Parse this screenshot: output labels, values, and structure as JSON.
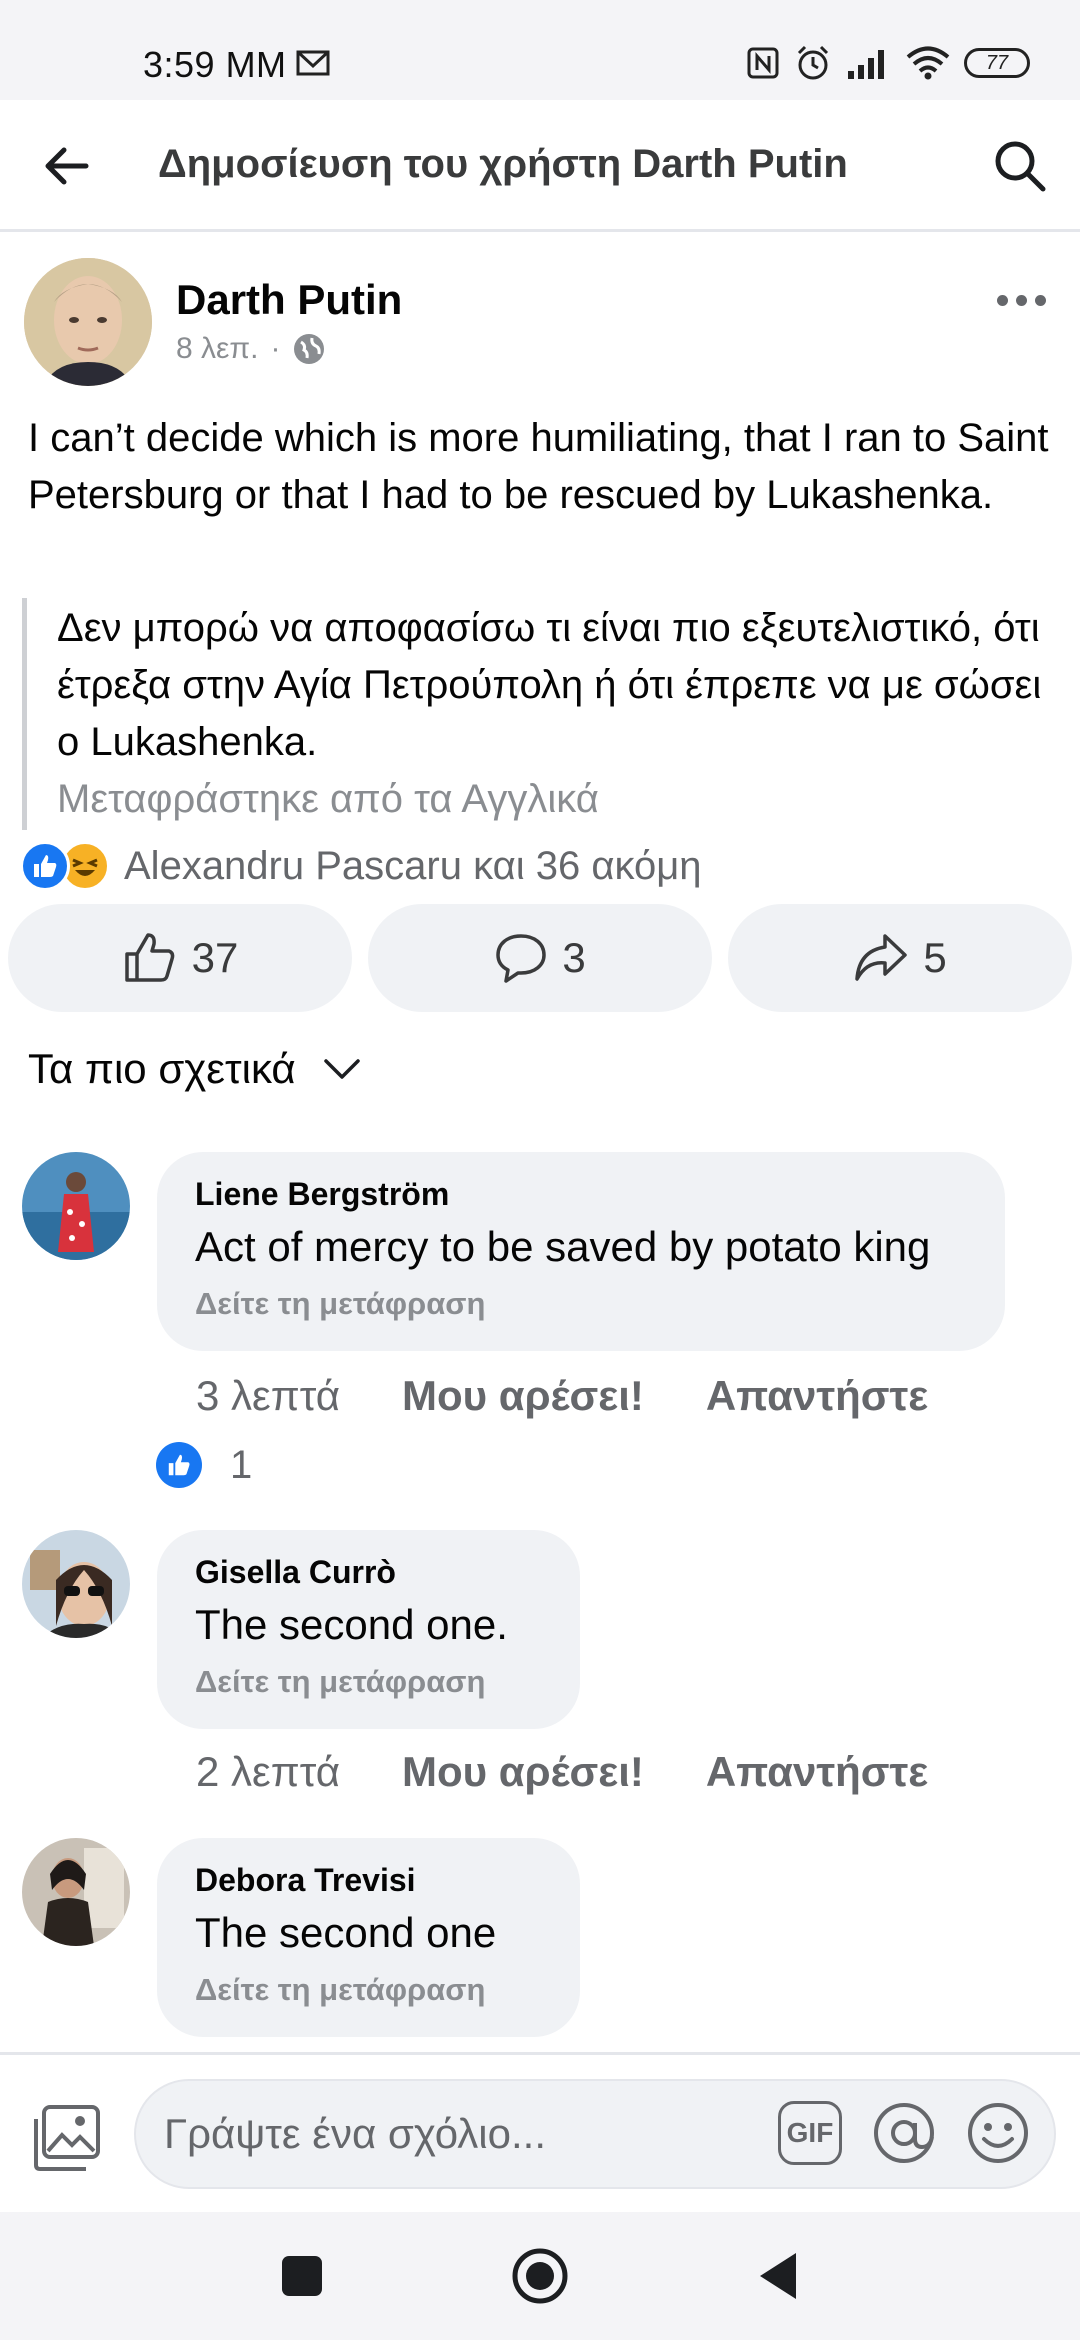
{
  "status_bar": {
    "time": "3:59 MM",
    "battery": "77"
  },
  "header": {
    "title": "Δημοσίευση του χρήστη Darth Putin"
  },
  "post": {
    "author": "Darth Putin",
    "time": "8 λεπ.",
    "separator": "·",
    "text": "I can’t decide which is more humiliating, that I ran to Saint Petersburg or that I had to be rescued by Lukashenka.",
    "translation": "Δεν μπορώ να αποφασίσω τι είναι πιο εξευτελιστικό, ότι έτρεξα στην Αγία Πετρούπολη ή ότι έπρεπε να με σώσει ο Lukashenka.",
    "translation_note": "Μεταφράστηκε από τα Αγγλικά",
    "reactions_text": "Alexandru Pascaru και 36 ακόμη",
    "actions": {
      "likes": "37",
      "comments": "3",
      "shares": "5"
    }
  },
  "sort": {
    "label": "Τα πιο σχετικά"
  },
  "comments": [
    {
      "name": "Liene Bergström",
      "text": "Act of mercy to be saved by potato king",
      "translate": "Δείτε τη μετάφραση",
      "time": "3 λεπτά",
      "like": "Μου αρέσει!",
      "reply": "Απαντήστε",
      "like_count": "1"
    },
    {
      "name": "Gisella Currò",
      "text": "The second one.",
      "translate": "Δείτε τη μετάφραση",
      "time": "2 λεπτά",
      "like": "Μου αρέσει!",
      "reply": "Απαντήστε"
    },
    {
      "name": "Debora Trevisi",
      "text": "The second one",
      "translate": "Δείτε τη μετάφραση"
    }
  ],
  "composer": {
    "placeholder": "Γράψτε ένα σχόλιο...",
    "gif_label": "GIF"
  },
  "colors": {
    "accent": "#1877f2",
    "bubble": "#f0f2f5",
    "muted": "#65676b"
  }
}
